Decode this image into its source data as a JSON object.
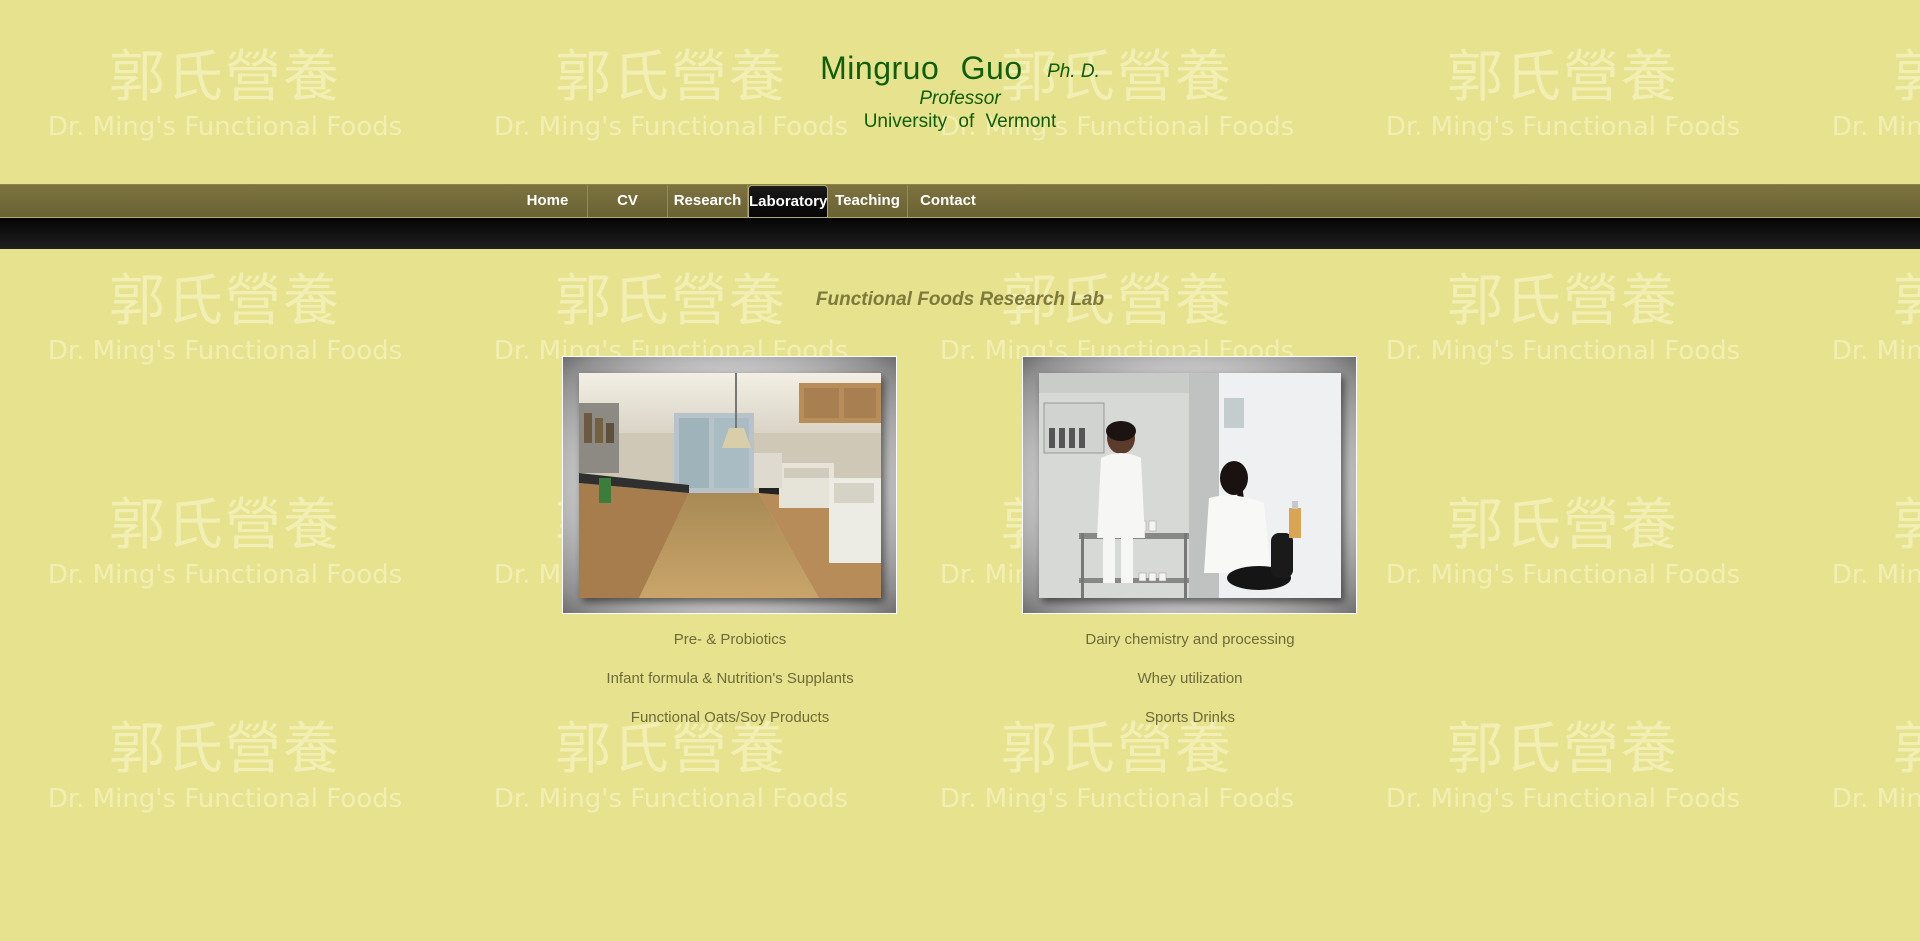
{
  "watermark": {
    "chinese": "郭氏營養",
    "english": "Dr. Ming's Functional Foods"
  },
  "header": {
    "name": "Mingruo  Guo",
    "degree": "Ph. D.",
    "title": "Professor",
    "university": "University  of  Vermont"
  },
  "nav": {
    "items": [
      {
        "label": "Home"
      },
      {
        "label": "CV"
      },
      {
        "label": "Research"
      },
      {
        "label": "Laboratory"
      },
      {
        "label": "Teaching"
      },
      {
        "label": "Contact"
      }
    ],
    "active": "Laboratory"
  },
  "main": {
    "title": "Functional Foods Research Lab",
    "left_captions": [
      "Pre- & Probiotics",
      "Infant formula & Nutrition's Supplants",
      "Functional Oats/Soy Products"
    ],
    "right_captions": [
      "Dairy chemistry and processing",
      "Whey utilization",
      "Sports Drinks"
    ]
  },
  "colors": {
    "background": "#e6e28d",
    "header_text": "#0f5e0a",
    "nav_bar": "#766d3b",
    "caption_text": "#6d6b3b"
  }
}
